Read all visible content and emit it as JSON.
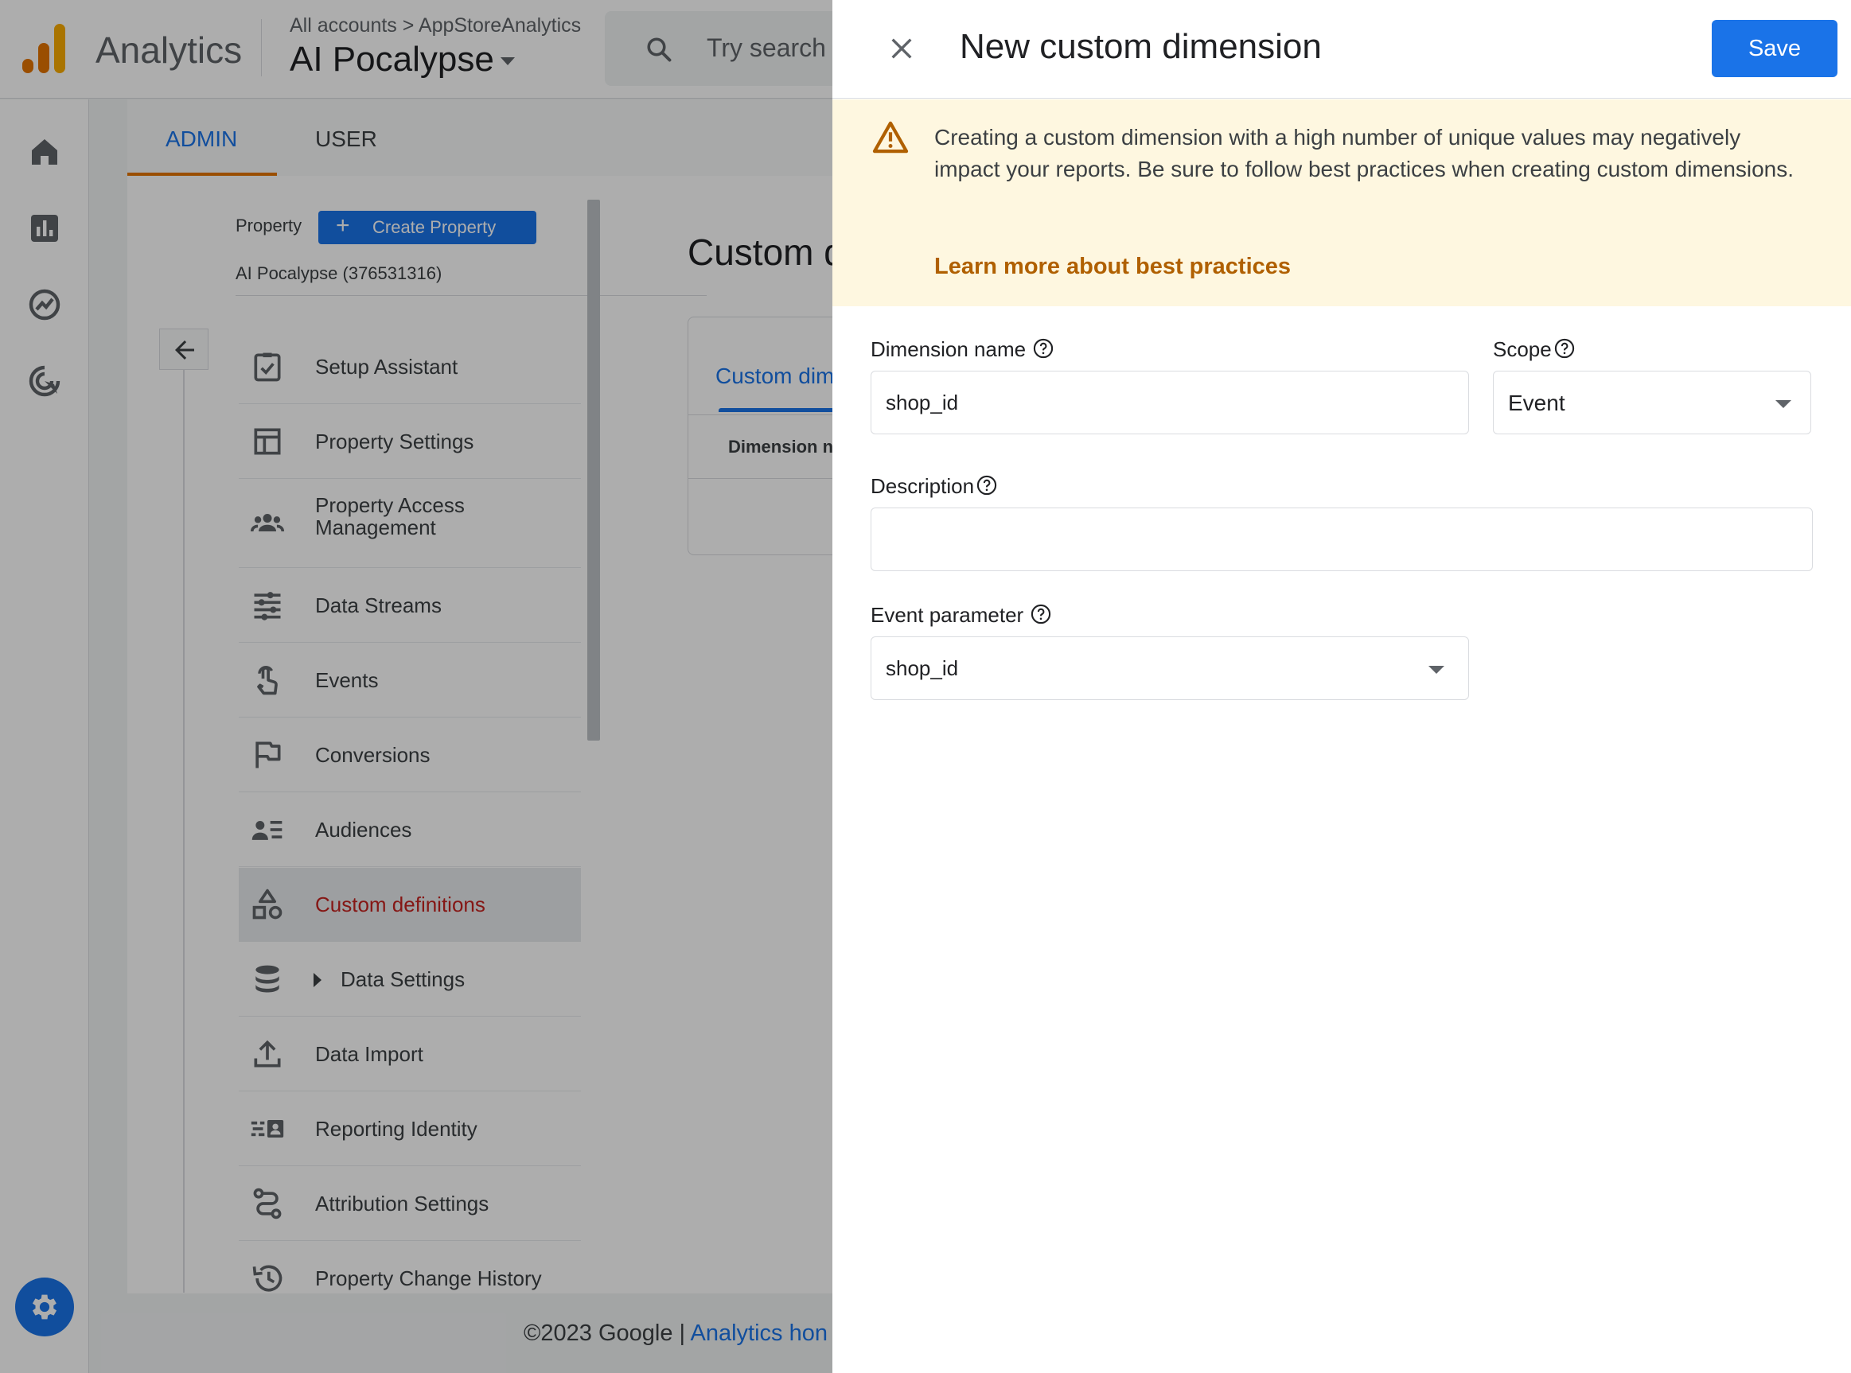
{
  "app": {
    "name": "Analytics",
    "breadcrumb": "All accounts > AppStoreAnalytics",
    "property_title": "AI Pocalypse",
    "search_placeholder": "Try search"
  },
  "colors": {
    "accent_blue": "#1a73e8",
    "active_red": "#c5221f",
    "warning_bg": "#fef7e0",
    "warning_link": "#b06000",
    "tab_underline": "#e37400"
  },
  "tabs": [
    {
      "label": "ADMIN",
      "active": true
    },
    {
      "label": "USER",
      "active": false
    }
  ],
  "admin_panel": {
    "property_label": "Property",
    "create_button": "Create Property",
    "property_id": "AI Pocalypse (376531316)",
    "nav_items": [
      {
        "label": "Setup Assistant",
        "icon": "checklist-icon"
      },
      {
        "label": "Property Settings",
        "icon": "layout-icon"
      },
      {
        "label": "Property Access Management",
        "icon": "people-icon"
      },
      {
        "label": "Data Streams",
        "icon": "streams-icon"
      },
      {
        "label": "Events",
        "icon": "touch-icon"
      },
      {
        "label": "Conversions",
        "icon": "flag-icon"
      },
      {
        "label": "Audiences",
        "icon": "audience-icon"
      },
      {
        "label": "Custom definitions",
        "icon": "shapes-icon",
        "active": true
      },
      {
        "label": "Data Settings",
        "icon": "database-icon"
      },
      {
        "label": "Data Import",
        "icon": "upload-icon"
      },
      {
        "label": "Reporting Identity",
        "icon": "identity-icon"
      },
      {
        "label": "Attribution Settings",
        "icon": "attribution-icon"
      },
      {
        "label": "Property Change History",
        "icon": "history-icon"
      }
    ]
  },
  "content": {
    "title": "Custom d",
    "card_tab": "Custom dim",
    "column_header": "Dimension n"
  },
  "footer": {
    "copyright": "©2023 Google | ",
    "link": "Analytics hon"
  },
  "drawer": {
    "title": "New custom dimension",
    "save_label": "Save",
    "warning_text": "Creating a custom dimension with a high number of unique values may negatively impact your reports. Be sure to follow best practices when creating custom dimensions.",
    "warning_link": "Learn more about best practices",
    "dimension_name": {
      "label": "Dimension name",
      "value": "shop_id"
    },
    "scope": {
      "label": "Scope",
      "value": "Event"
    },
    "description": {
      "label": "Description",
      "value": ""
    },
    "event_parameter": {
      "label": "Event parameter",
      "value": "shop_id"
    }
  }
}
